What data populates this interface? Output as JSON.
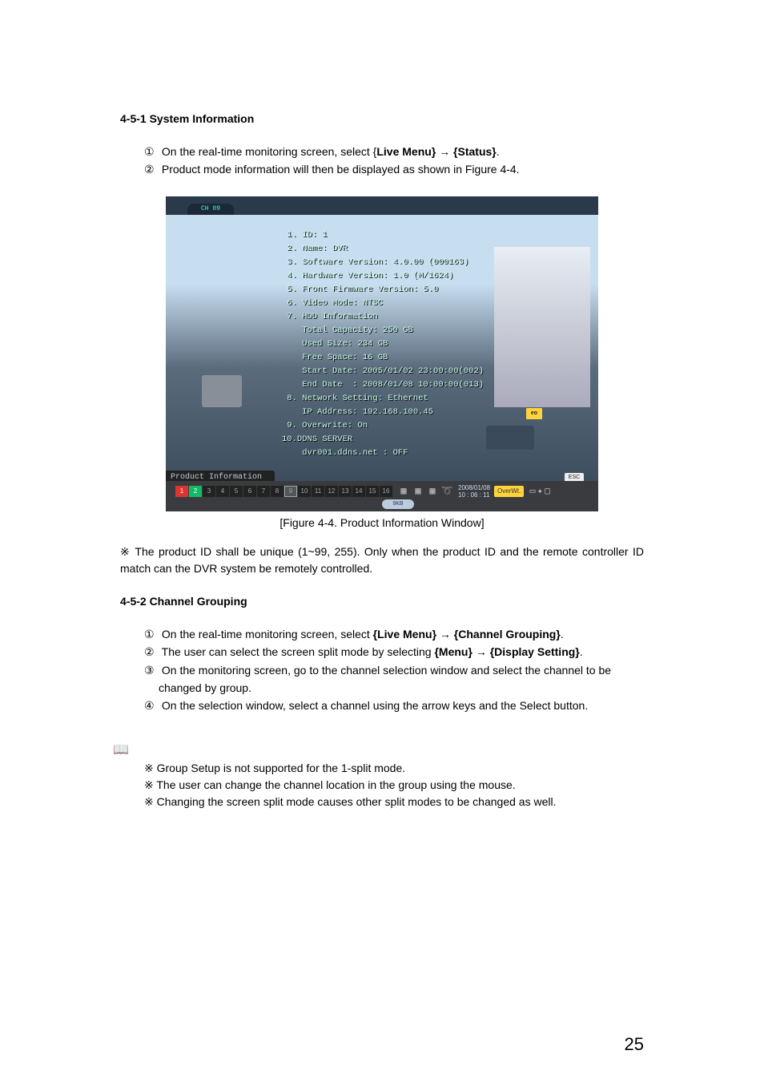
{
  "sec1": {
    "heading": "4-5-1  System Information",
    "step1_pre": "On the real-time monitoring screen, select {",
    "step1_b1": "Live Menu} → {Status}",
    "step1_post": ".",
    "step2": "Product mode information will then be displayed as shown in Figure 4-4."
  },
  "figure": {
    "tab": "CH 09",
    "overlay": " 1. ID: 1\n 2. Name: DVR\n 3. Software Version: 4.0.00 (000163)\n 4. Hardware Version: 1.0 (M/1624)\n 5. Front Firmware Version: 5.0\n 6. Video Mode: NTSC\n 7. HDD Information\n    Total Capacity: 250 GB\n    Used Size: 234 GB\n    Free Space: 16 GB\n    Start Date: 2005/01/02 23:00:00(002)\n    End Date  : 2008/01/08 10:00:00(013)\n 8. Network Setting: Ethernet\n    IP Address: 192.168.100.45\n 9. Overwrite: On\n10.DDNS SERVER\n    dvr001.ddns.net : OFF",
    "prod_bar": "Product Information",
    "esc": "ESC",
    "eo": "eo",
    "ts_date": "2008/01/08",
    "ts_time": "10 : 06 : 11",
    "overwt": "OverWt.",
    "gkb": "9KB",
    "caption": "[Figure 4-4. Product Information Window]",
    "channels": [
      "1",
      "2",
      "3",
      "4",
      "5",
      "6",
      "7",
      "8",
      "9",
      "10",
      "11",
      "12",
      "13",
      "14",
      "15",
      "16"
    ]
  },
  "note1": "※ The product ID shall be unique (1~99, 255). Only when the product ID and the remote controller ID match can the DVR system be remotely controlled.",
  "sec2": {
    "heading": "4-5-2  Channel Grouping",
    "s1_pre": "On the real-time monitoring screen, select ",
    "s1_b": "{Live Menu} → {Channel Grouping}",
    "s1_post": ".",
    "s2_pre": "The user can select the screen split mode by selecting ",
    "s2_b": "{Menu} → {Display Setting}",
    "s2_post": ".",
    "s3": "On the monitoring screen, go to the channel selection window and select the channel to be changed by group.",
    "s4": "On the selection window, select a channel using the arrow keys and the Select button."
  },
  "notes2": {
    "a": "※ Group Setup is not supported for the 1-split mode.",
    "b": "※ The user can change the channel location in the group using the mouse.",
    "c": "※ Changing the screen split mode causes other split modes to be changed as well."
  },
  "pagenum": "25"
}
